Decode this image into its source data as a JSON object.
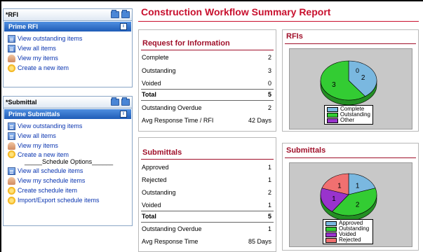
{
  "rfi_panel": {
    "header": "*RFI",
    "section": "Prime RFI",
    "items": [
      "View outstanding items",
      "View all items",
      "View my items",
      "Create a new item"
    ]
  },
  "submittal_panel": {
    "header": "*Submittal",
    "section": "Prime Submittals",
    "items": [
      "View outstanding items",
      "View all items",
      "View my items",
      "Create a new item"
    ],
    "schedule_heading": "_____Schedule Options______",
    "schedule_items": [
      "View all schedule items",
      "View my schedule items",
      "Create schedule item",
      "Import/Export schedule items"
    ]
  },
  "report": {
    "title": "Construction Workflow Summary Report",
    "rfi_table": {
      "title": "Request for Information",
      "rows": [
        {
          "label": "Complete",
          "value": "2"
        },
        {
          "label": "Outstanding",
          "value": "3"
        },
        {
          "label": "Voided",
          "value": "0"
        }
      ],
      "total": {
        "label": "Total",
        "value": "5"
      },
      "overdue": {
        "label": "Outstanding Overdue",
        "value": "2"
      },
      "avg": {
        "label": "Avg Response Time / RFI",
        "value": "42 Days"
      }
    },
    "submittal_table": {
      "title": "Submittals",
      "rows": [
        {
          "label": "Approved",
          "value": "1"
        },
        {
          "label": "Rejected",
          "value": "1"
        },
        {
          "label": "Outstanding",
          "value": "2"
        },
        {
          "label": "Voided",
          "value": "1"
        }
      ],
      "total": {
        "label": "Total",
        "value": "5"
      },
      "overdue": {
        "label": "Outstanding Overdue",
        "value": "1"
      },
      "avg": {
        "label": "Avg Response Time",
        "value": "85 Days"
      }
    },
    "rfi_chart_title": "RFIs",
    "submittal_chart_title": "Submittals"
  },
  "chart_data": [
    {
      "type": "pie",
      "title": "RFIs",
      "categories": [
        "Complete",
        "Outstanding",
        "Other"
      ],
      "values": [
        2,
        3,
        0
      ],
      "colors": [
        "#7ab8e0",
        "#33cc33",
        "#9933cc"
      ],
      "legend": "bottom"
    },
    {
      "type": "pie",
      "title": "Submittals",
      "categories": [
        "Approved",
        "Outstanding",
        "Voided",
        "Rejected"
      ],
      "values": [
        1,
        2,
        1,
        1
      ],
      "colors": [
        "#7ab8e0",
        "#33cc33",
        "#9933cc",
        "#f07070"
      ],
      "legend": "bottom"
    }
  ]
}
